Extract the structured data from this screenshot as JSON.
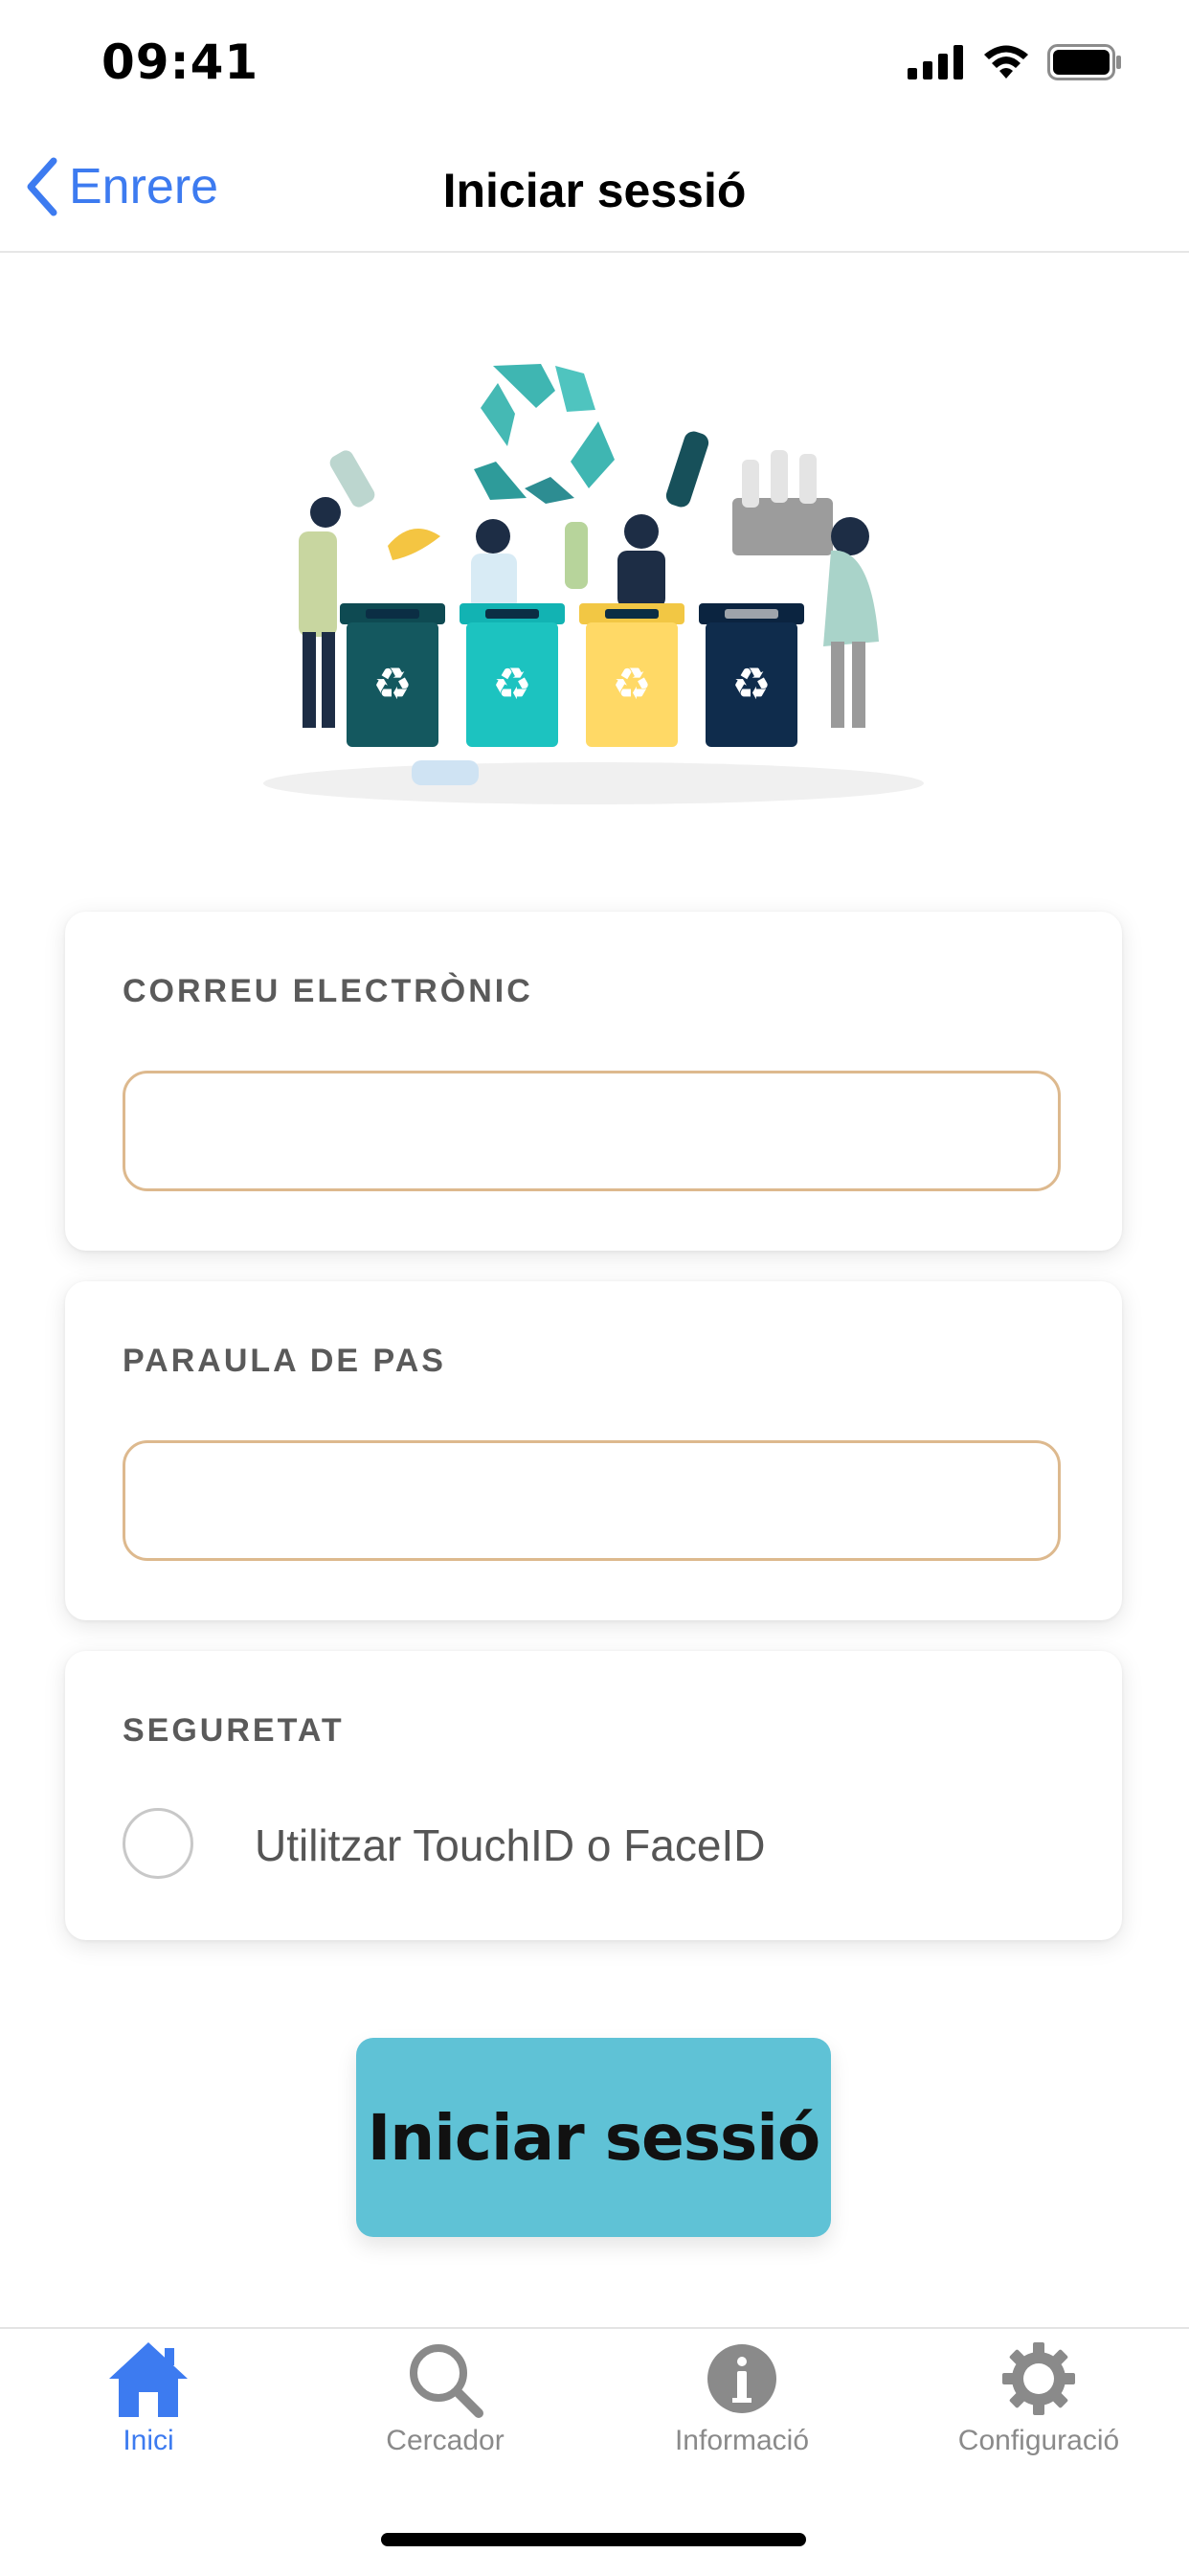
{
  "status_bar": {
    "time": "09:41",
    "icons": [
      "signal-icon",
      "wifi-icon",
      "battery-icon"
    ]
  },
  "navbar": {
    "back_label": "Enrere",
    "title": "Iniciar sessió",
    "accent": "#3d7bf0"
  },
  "form": {
    "email": {
      "label": "CORREU ELECTRÒNIC",
      "value": "",
      "placeholder": ""
    },
    "password": {
      "label": "PARAULA DE PAS",
      "value": "",
      "placeholder": ""
    },
    "security": {
      "label": "SEGURETAT",
      "option_label": "Utilitzar TouchID o FaceID",
      "checked": false
    }
  },
  "submit_label": "Iniciar sessió",
  "colors": {
    "button": "#5fc2d6",
    "field_border": "#ddb98e",
    "tab_active": "#3d7bf0",
    "tab_inactive": "#8a8a8a"
  },
  "tabbar": {
    "items": [
      {
        "label": "Inici",
        "icon": "home-icon",
        "active": true
      },
      {
        "label": "Cercador",
        "icon": "search-icon",
        "active": false
      },
      {
        "label": "Informació",
        "icon": "info-icon",
        "active": false
      },
      {
        "label": "Configuració",
        "icon": "gear-icon",
        "active": false
      }
    ]
  }
}
